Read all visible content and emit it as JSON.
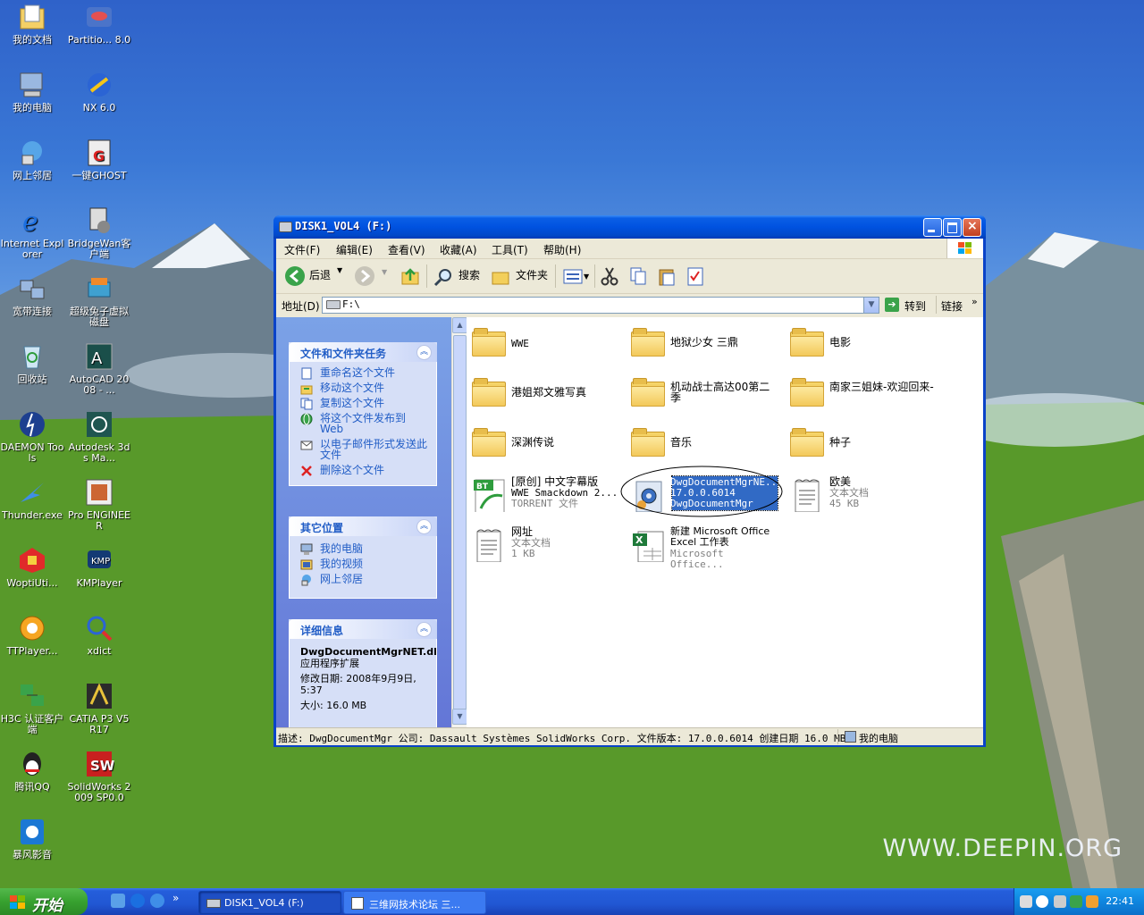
{
  "desktop": {
    "watermark": "WWW.DEEPIN.ORG",
    "icons": [
      {
        "label": "我的文档",
        "icon": "my-documents-icon"
      },
      {
        "label": "Partitio... 8.0",
        "icon": "partition-magic-icon"
      },
      {
        "label": "我的电脑",
        "icon": "my-computer-icon"
      },
      {
        "label": "NX 6.0",
        "icon": "nx-icon"
      },
      {
        "label": "网上邻居",
        "icon": "network-places-icon"
      },
      {
        "label": "一键GHOST",
        "icon": "ghost-icon"
      },
      {
        "label": "Internet Explorer",
        "icon": "ie-icon"
      },
      {
        "label": "BridgeWan客户端",
        "icon": "bridgewan-icon"
      },
      {
        "label": "宽带连接",
        "icon": "broadband-icon"
      },
      {
        "label": "超级兔子虚拟磁盘",
        "icon": "rabbit-disk-icon"
      },
      {
        "label": "回收站",
        "icon": "recycle-bin-icon"
      },
      {
        "label": "AutoCAD 2008 - ...",
        "icon": "autocad-icon"
      },
      {
        "label": "DAEMON Tools",
        "icon": "daemon-tools-icon"
      },
      {
        "label": "Autodesk 3ds Ma...",
        "icon": "3dsmax-icon"
      },
      {
        "label": "Thunder.exe",
        "icon": "thunder-icon"
      },
      {
        "label": "Pro ENGINEER",
        "icon": "pro-engineer-icon"
      },
      {
        "label": "WoptiUti...",
        "icon": "wopti-icon"
      },
      {
        "label": "KMPlayer",
        "icon": "kmplayer-icon"
      },
      {
        "label": "TTPlayer...",
        "icon": "ttplayer-icon"
      },
      {
        "label": "xdict",
        "icon": "xdict-icon"
      },
      {
        "label": "H3C 认证客户端",
        "icon": "h3c-icon"
      },
      {
        "label": "CATIA P3 V5R17",
        "icon": "catia-icon"
      },
      {
        "label": "腾讯QQ",
        "icon": "qq-icon"
      },
      {
        "label": "SolidWorks 2009 SP0.0",
        "icon": "solidworks-icon"
      },
      {
        "label": "暴风影音",
        "icon": "baofeng-icon"
      }
    ]
  },
  "window": {
    "title": "DISK1_VOL4 (F:)",
    "menu": [
      "文件(F)",
      "编辑(E)",
      "查看(V)",
      "收藏(A)",
      "工具(T)",
      "帮助(H)"
    ],
    "toolbar": {
      "back": "后退",
      "search": "搜索",
      "folders": "文件夹"
    },
    "address": {
      "label": "地址(D)",
      "value": "F:\\",
      "go": "转到",
      "links": "链接"
    },
    "tasks": {
      "title": "文件和文件夹任务",
      "items": [
        "重命名这个文件",
        "移动这个文件",
        "复制这个文件",
        "将这个文件发布到 Web",
        "以电子邮件形式发送此文件",
        "删除这个文件"
      ]
    },
    "other_places": {
      "title": "其它位置",
      "items": [
        "我的电脑",
        "我的视频",
        "网上邻居"
      ]
    },
    "details": {
      "title": "详细信息",
      "name": "DwgDocumentMgrNET.dll",
      "type": "应用程序扩展",
      "modified": "修改日期: 2008年9月9日, 5:37",
      "size": "大小: 16.0 MB"
    },
    "files": [
      {
        "name": "WWE",
        "type": "folder"
      },
      {
        "name": "地狱少女 三鼎",
        "type": "folder"
      },
      {
        "name": "电影",
        "type": "folder"
      },
      {
        "name": "港姐郑文雅写真",
        "type": "folder"
      },
      {
        "name": "机动战士高达00第二季",
        "type": "folder"
      },
      {
        "name": "南家三姐妹-欢迎回来-",
        "type": "folder"
      },
      {
        "name": "深渊传说",
        "type": "folder"
      },
      {
        "name": "音乐",
        "type": "folder"
      },
      {
        "name": "种子",
        "type": "folder"
      },
      {
        "name": "[原创] 中文字幕版",
        "line2": "WWE Smackdown 2...",
        "line3": "TORRENT 文件",
        "type": "torrent"
      },
      {
        "name": "DwgDocumentMgrNE...",
        "line2": "17.0.0.6014",
        "line3": "DwgDocumentMgr",
        "type": "dll"
      },
      {
        "name": "欧美",
        "line2": "文本文档",
        "line3": "45 KB",
        "type": "text"
      },
      {
        "name": "网址",
        "line2": "文本文档",
        "line3": "1 KB",
        "type": "text"
      },
      {
        "name": "新建 Microsoft Office Excel 工作表",
        "line3": "Microsoft Office...",
        "type": "excel"
      }
    ],
    "status": {
      "description": "描述: DwgDocumentMgr 公司: Dassault Systèmes SolidWorks Corp. 文件版本: 17.0.0.6014 创建日期 16.0 MB",
      "location": "我的电脑"
    }
  },
  "taskbar": {
    "start": "开始",
    "tasks": [
      "DISK1_VOL4 (F:)",
      "三维网技术论坛 三..."
    ],
    "clock": "22:41"
  },
  "colors": {
    "selection": "#316ac5",
    "xp_blue": "#0052e0",
    "link_blue": "#215dc6"
  }
}
